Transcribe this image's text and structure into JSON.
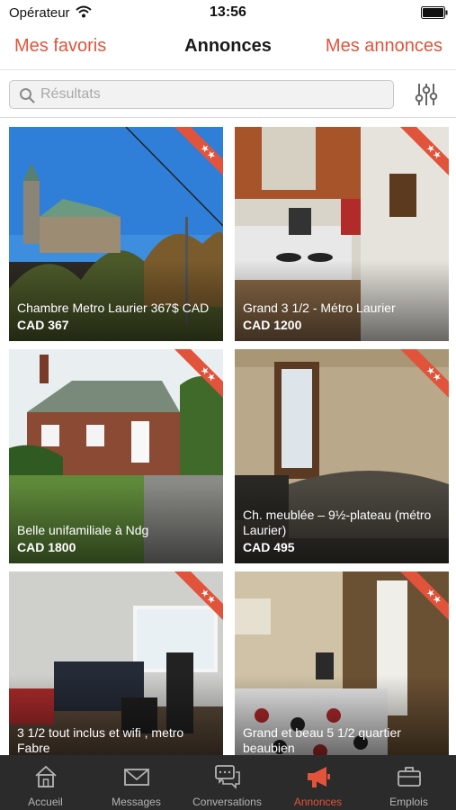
{
  "status_bar": {
    "carrier": "Opérateur",
    "time": "13:56"
  },
  "nav": {
    "left": "Mes favoris",
    "title": "Annonces",
    "right": "Mes annonces"
  },
  "search": {
    "placeholder": "Résultats",
    "value": ""
  },
  "listings": [
    {
      "title": "Chambre Metro Laurier 367$ CAD",
      "price": "CAD 367"
    },
    {
      "title": "Grand 3 1/2 - Métro Laurier",
      "price": "CAD 1200"
    },
    {
      "title": "Belle unifamiliale à Ndg",
      "price": "CAD 1800"
    },
    {
      "title": "Ch. meublée – 9½-plateau (métro Laurier)",
      "price": "CAD 495"
    },
    {
      "title": "3 1/2 tout inclus et wifi , metro Fabre",
      "price": ""
    },
    {
      "title": "Grand et beau 5 1/2 quartier beaubien",
      "price": ""
    }
  ],
  "tabs": [
    {
      "label": "Accueil",
      "icon": "home-icon"
    },
    {
      "label": "Messages",
      "icon": "envelope-icon"
    },
    {
      "label": "Conversations",
      "icon": "chat-bubbles-icon"
    },
    {
      "label": "Annonces",
      "icon": "megaphone-icon",
      "active": true
    },
    {
      "label": "Emplois",
      "icon": "briefcase-icon"
    }
  ],
  "colors": {
    "accent": "#e1533a",
    "tab_bar": "#2b2b2b",
    "ribbon": "#e1533a"
  }
}
